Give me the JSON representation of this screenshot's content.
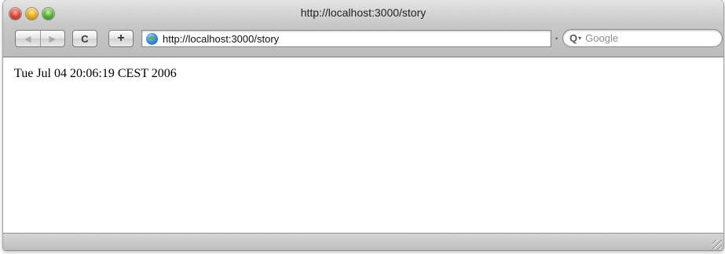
{
  "window": {
    "title": "http://localhost:3000/story"
  },
  "toolbar": {
    "back_icon": "◀",
    "forward_icon": "▶",
    "reload_icon": "C",
    "add_bookmark_icon": "+",
    "url": "http://localhost:3000/story",
    "search_placeholder": "Google",
    "search_icon": "Q",
    "search_caret": "▾"
  },
  "content": {
    "text": "Tue Jul 04 20:06:19 CEST 2006"
  },
  "colors": {
    "metal_top": "#e6e6e6",
    "metal_bottom": "#bcbcbc",
    "close": "#e0483a",
    "minimize": "#e9b318",
    "zoom": "#5bb43a"
  }
}
